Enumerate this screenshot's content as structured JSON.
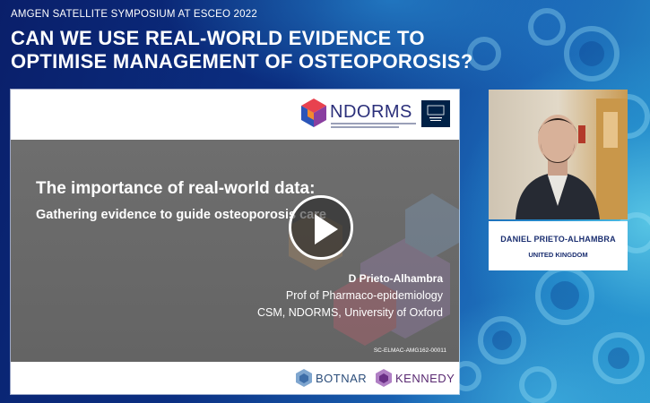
{
  "event": {
    "label": "AMGEN SATELLITE SYMPOSIUM AT ESCEO 2022",
    "headline_line1": "CAN WE USE REAL-WORLD EVIDENCE TO",
    "headline_line2": "OPTIMISE MANAGEMENT OF OSTEOPOROSIS?"
  },
  "slide": {
    "org_logo_text": "NDORMS",
    "title": "The importance of real-world data:",
    "subtitle": "Gathering evidence to guide osteoporosis care",
    "presenter_name": "D Prieto-Alhambra",
    "presenter_role": "Prof of Pharmaco-epidemiology",
    "presenter_affiliation": "CSM, NDORMS, University of Oxford",
    "code": "SC-ELMAC-AMG162-00011",
    "footer_logo_1": "BOTNAR",
    "footer_logo_2": "KENNEDY"
  },
  "speaker": {
    "name": "DANIEL PRIETO-ALHAMBRA",
    "country": "UNITED KINGDOM"
  },
  "player": {
    "play_icon": "play-icon"
  },
  "colors": {
    "background": "#0b2f82",
    "accent_cyan": "#5ac8e6",
    "speaker_text": "#1a2e70",
    "slide_body": "#6e6e6e"
  }
}
